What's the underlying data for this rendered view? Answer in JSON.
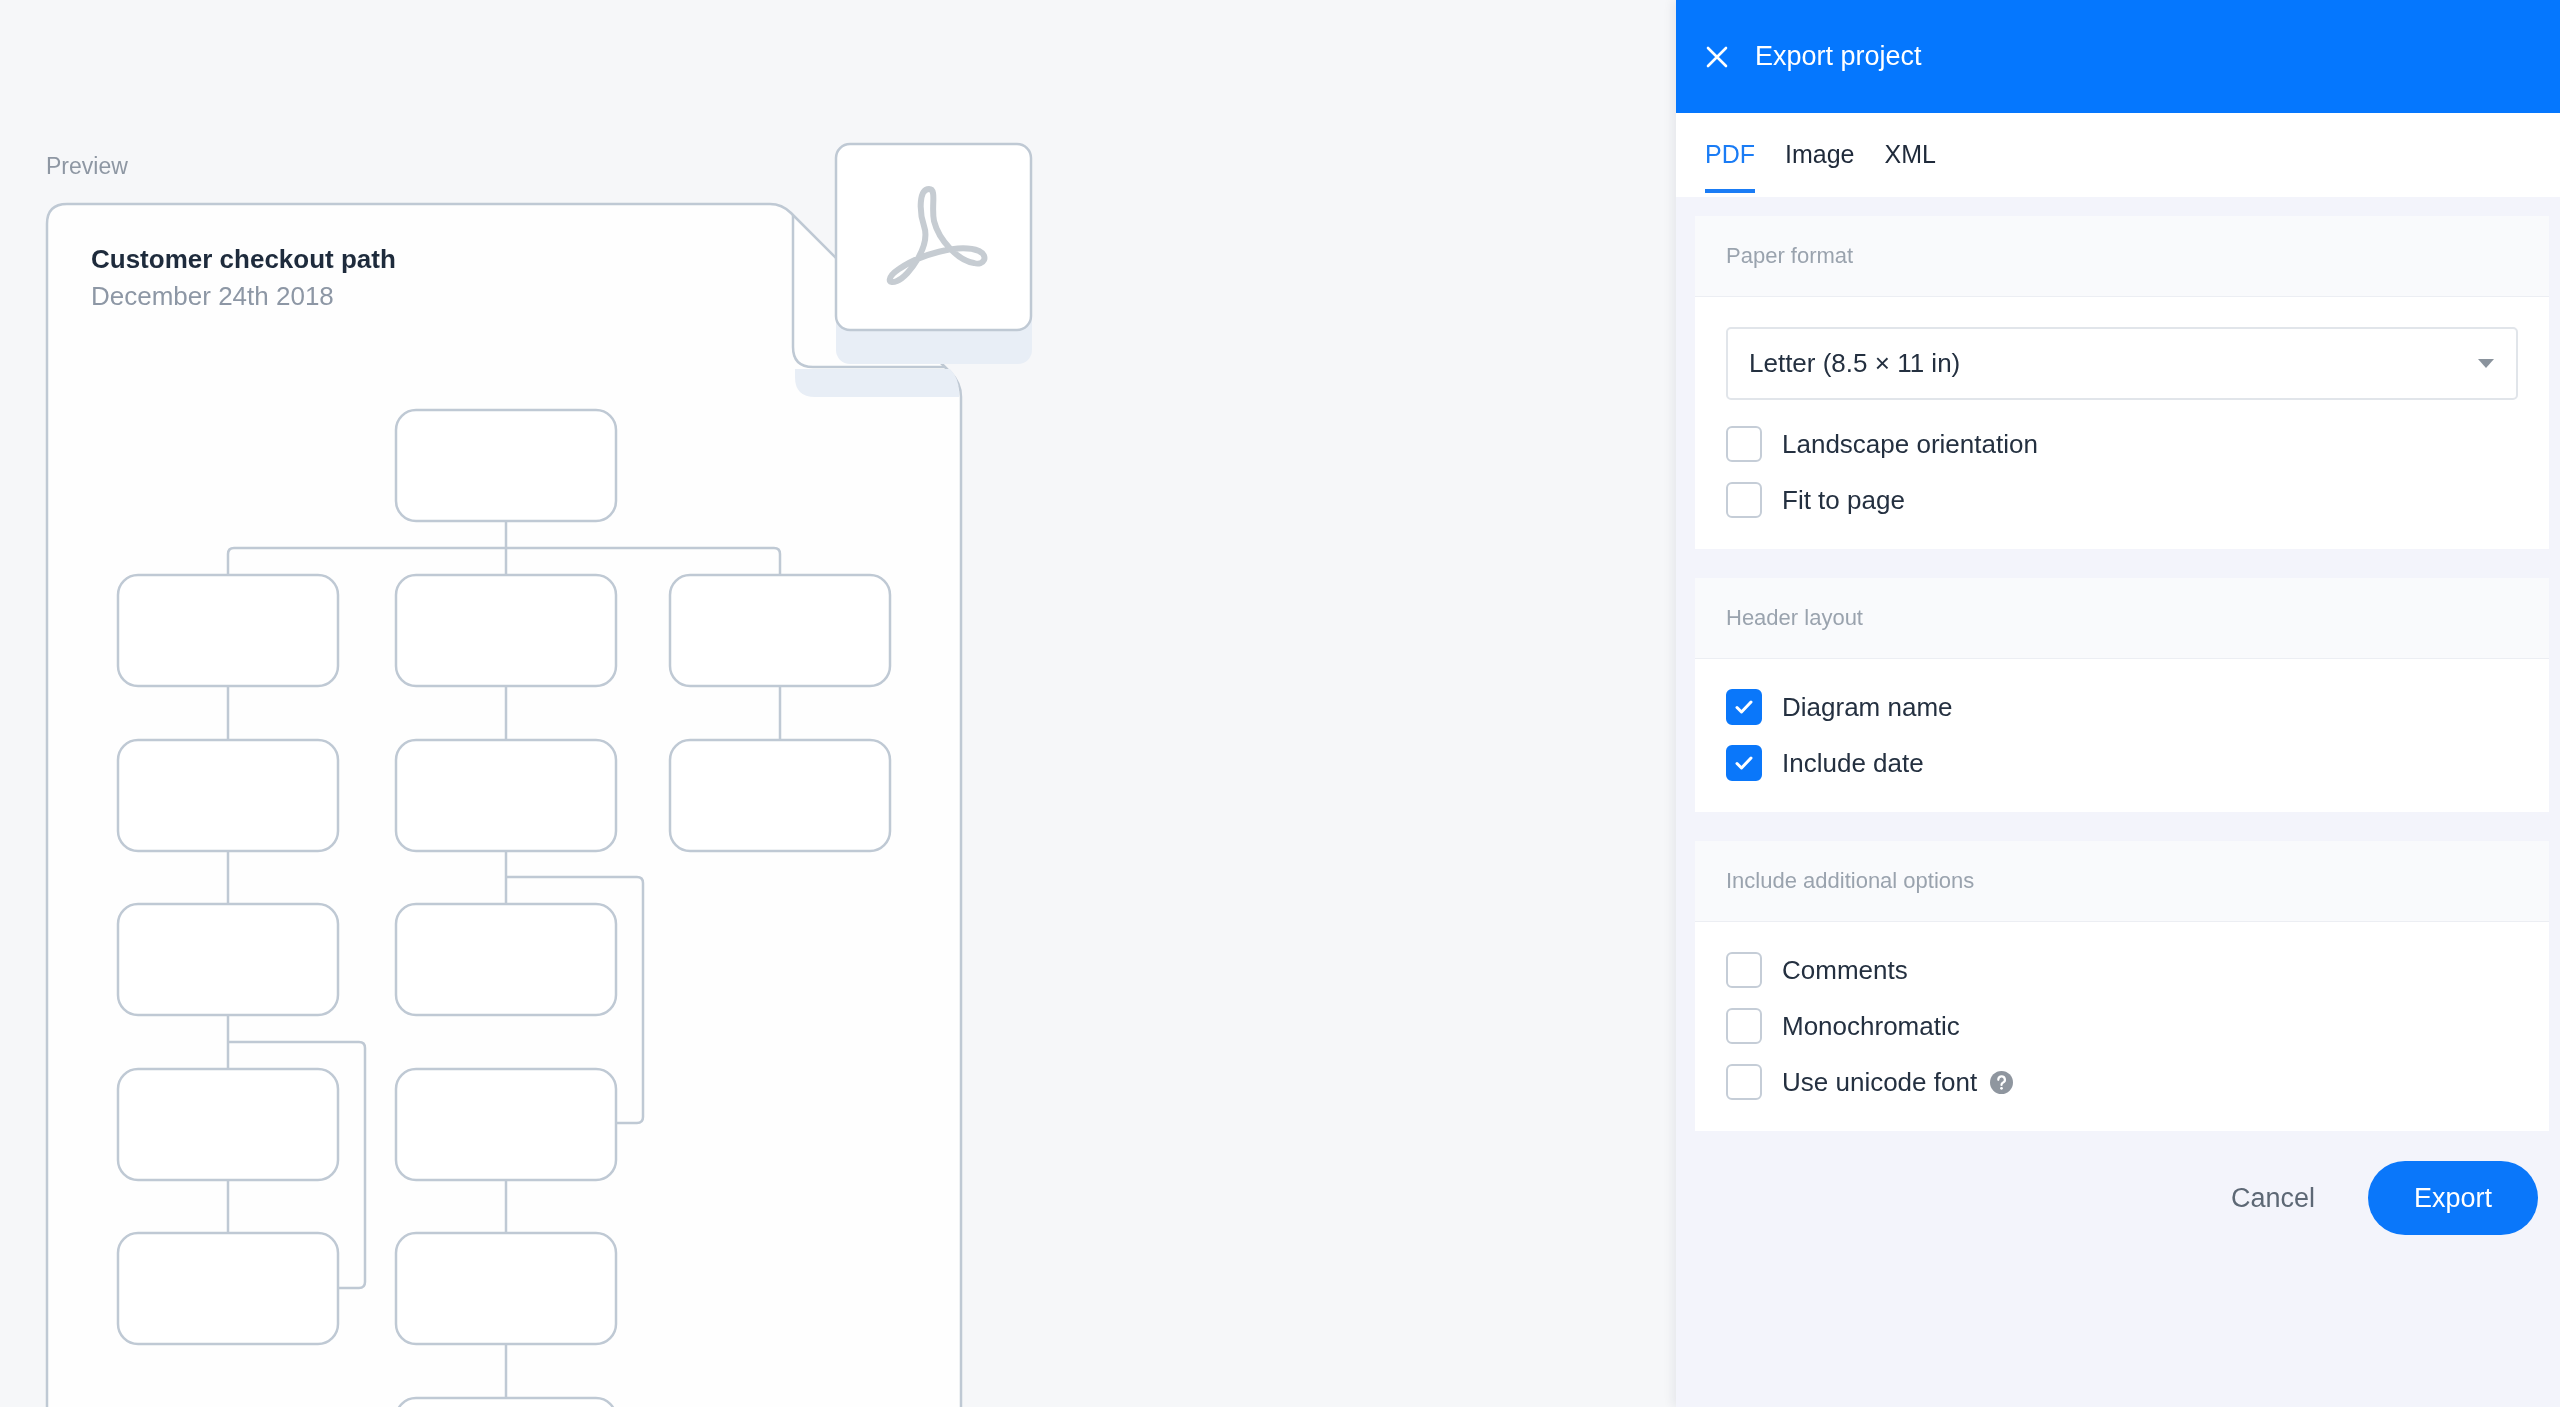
{
  "preview": {
    "label": "Preview",
    "document": {
      "title": "Customer checkout path",
      "date": "December 24th 2018"
    }
  },
  "panel": {
    "title": "Export project",
    "tabs": [
      {
        "label": "PDF",
        "selected": true
      },
      {
        "label": "Image",
        "selected": false
      },
      {
        "label": "XML",
        "selected": false
      }
    ],
    "sections": [
      {
        "title": "Paper format",
        "select": {
          "value": "Letter (8.5 × 11 in)"
        },
        "options": [
          {
            "label": "Landscape orientation",
            "checked": false
          },
          {
            "label": "Fit to page",
            "checked": false
          }
        ]
      },
      {
        "title": "Header layout",
        "options": [
          {
            "label": "Diagram name",
            "checked": true
          },
          {
            "label": "Include date",
            "checked": true
          }
        ]
      },
      {
        "title": "Include additional options",
        "options": [
          {
            "label": "Comments",
            "checked": false
          },
          {
            "label": "Monochromatic",
            "checked": false
          },
          {
            "label": "Use unicode font",
            "checked": false,
            "help": true
          }
        ]
      }
    ],
    "buttons": [
      {
        "label": "Cancel",
        "kind": "text"
      },
      {
        "label": "Export",
        "kind": "primary"
      }
    ]
  }
}
